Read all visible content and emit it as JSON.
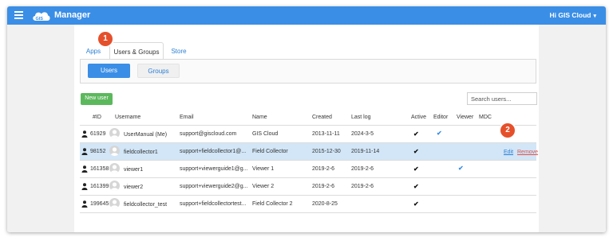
{
  "topbar": {
    "title": "Manager",
    "logo_text": "GIS",
    "greeting": "Hi GIS Cloud",
    "caret": "▾"
  },
  "tabs": [
    {
      "label": "Apps",
      "active": false
    },
    {
      "label": "Users & Groups",
      "active": true
    },
    {
      "label": "Store",
      "active": false
    }
  ],
  "subtabs": [
    {
      "label": "Users",
      "active": true
    },
    {
      "label": "Groups",
      "active": false
    }
  ],
  "new_user_button": "New user",
  "search": {
    "placeholder": "Search users...",
    "value": ""
  },
  "table": {
    "headers": [
      "#ID",
      "Username",
      "Email",
      "Name",
      "Created",
      "Last log",
      "Active",
      "Editor",
      "Viewer",
      "MDC"
    ],
    "rows": [
      {
        "id": "61929",
        "username": "UserManual (Me)",
        "email": "support@giscloud.com",
        "name": "GIS Cloud",
        "created": "2013-11-11",
        "last_log": "2024-3-5",
        "active": "✔",
        "editor": "✔",
        "viewer": "",
        "selected": false
      },
      {
        "id": "98152",
        "username": "fieldcollector1",
        "email": "support+fieldcollector1@...",
        "name": "Field Collector",
        "created": "2015-12-30",
        "last_log": "2019-11-14",
        "active": "✔",
        "editor": "",
        "viewer": "",
        "selected": true,
        "edit": "Edit",
        "remove": "Remove"
      },
      {
        "id": "161358",
        "username": "viewer1",
        "email": "support+viewerguide1@g...",
        "name": "Viewer 1",
        "created": "2019-2-6",
        "last_log": "2019-2-6",
        "active": "✔",
        "editor": "",
        "viewer": "✔",
        "selected": false
      },
      {
        "id": "161399",
        "username": "viewer2",
        "email": "support+viewerguide2@g...",
        "name": "Viewer 2",
        "created": "2019-2-6",
        "last_log": "2019-2-6",
        "active": "✔",
        "editor": "",
        "viewer": "",
        "selected": false
      },
      {
        "id": "199645",
        "username": "fieldcollector_test",
        "email": "support+fieldcollectortest...",
        "name": "Field Collector 2",
        "created": "2020-8-25",
        "last_log": "",
        "active": "✔",
        "editor": "",
        "viewer": "",
        "selected": false
      }
    ]
  },
  "badges": [
    "1",
    "2"
  ],
  "colors": {
    "topbar": "#3a8ee6",
    "badge": "#e5502b",
    "new_user": "#5cb85c",
    "selected_row": "#d2e6f7",
    "remove": "#d9534f"
  }
}
